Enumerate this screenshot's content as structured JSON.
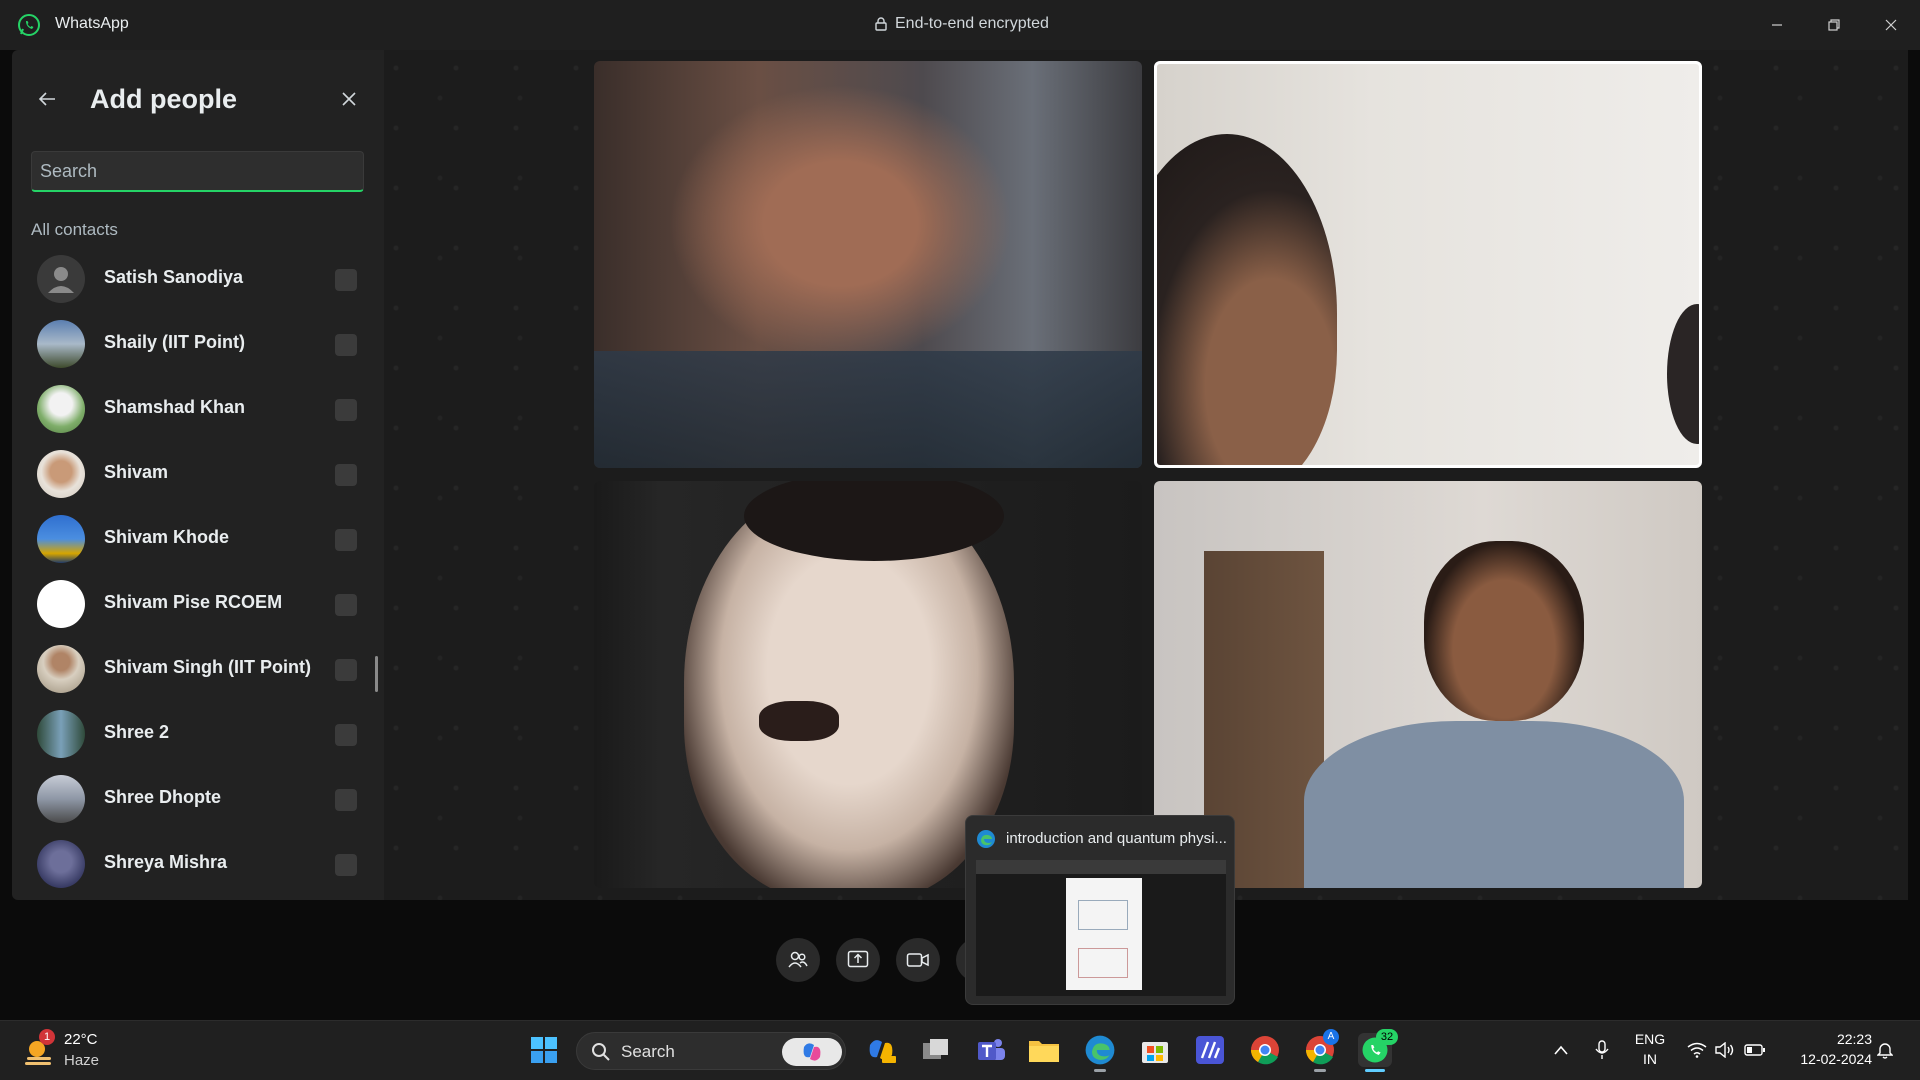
{
  "titlebar": {
    "app_name": "WhatsApp",
    "encryption_text": "End-to-end encrypted"
  },
  "panel": {
    "title": "Add people",
    "search_placeholder": "Search",
    "section_label": "All contacts",
    "contacts": [
      {
        "name": "Satish Sanodiya"
      },
      {
        "name": "Shaily (IIT Point)"
      },
      {
        "name": "Shamshad Khan"
      },
      {
        "name": "Shivam"
      },
      {
        "name": "Shivam Khode"
      },
      {
        "name": "Shivam Pise RCOEM"
      },
      {
        "name": "Shivam Singh (IIT Point)"
      },
      {
        "name": "Shree 2"
      },
      {
        "name": "Shree Dhopte"
      },
      {
        "name": "Shreya Mishra"
      }
    ]
  },
  "preview": {
    "title": "introduction and quantum physi..."
  },
  "taskbar": {
    "weather_badge": "1",
    "weather_temp": "22°C",
    "weather_condition": "Haze",
    "search_label": "Search",
    "whatsapp_badge": "32",
    "chrome_badge": "A",
    "lang_top": "ENG",
    "lang_bottom": "IN",
    "time": "22:23",
    "date": "12-02-2024"
  },
  "colors": {
    "accent_green": "#25d366",
    "panel_bg": "#222222",
    "call_bg": "#1c1c1c",
    "taskbar_bg": "#202020"
  }
}
